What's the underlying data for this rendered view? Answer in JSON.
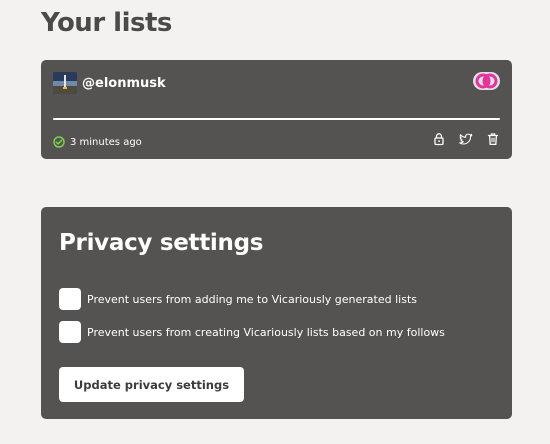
{
  "lists_section": {
    "title": "Your lists"
  },
  "lists": [
    {
      "name": "@elonmusk",
      "status_text": "3 minutes ago",
      "progress_fraction": 1.0,
      "status_icon": "check-circle-icon",
      "actions": [
        "lock-icon",
        "twitter-icon",
        "trash-icon"
      ],
      "colors": {
        "status": "#7bd14a",
        "brand_pink": "#e4359b"
      }
    }
  ],
  "privacy": {
    "title": "Privacy settings",
    "options": [
      {
        "label": "Prevent users from adding me to Vicariously generated lists",
        "checked": false
      },
      {
        "label": "Prevent users from creating Vicariously lists based on my follows",
        "checked": false
      }
    ],
    "button_label": "Update privacy settings"
  },
  "colors": {
    "background": "#f4f2f0",
    "card": "#545351",
    "title_text": "#4a4a48"
  }
}
